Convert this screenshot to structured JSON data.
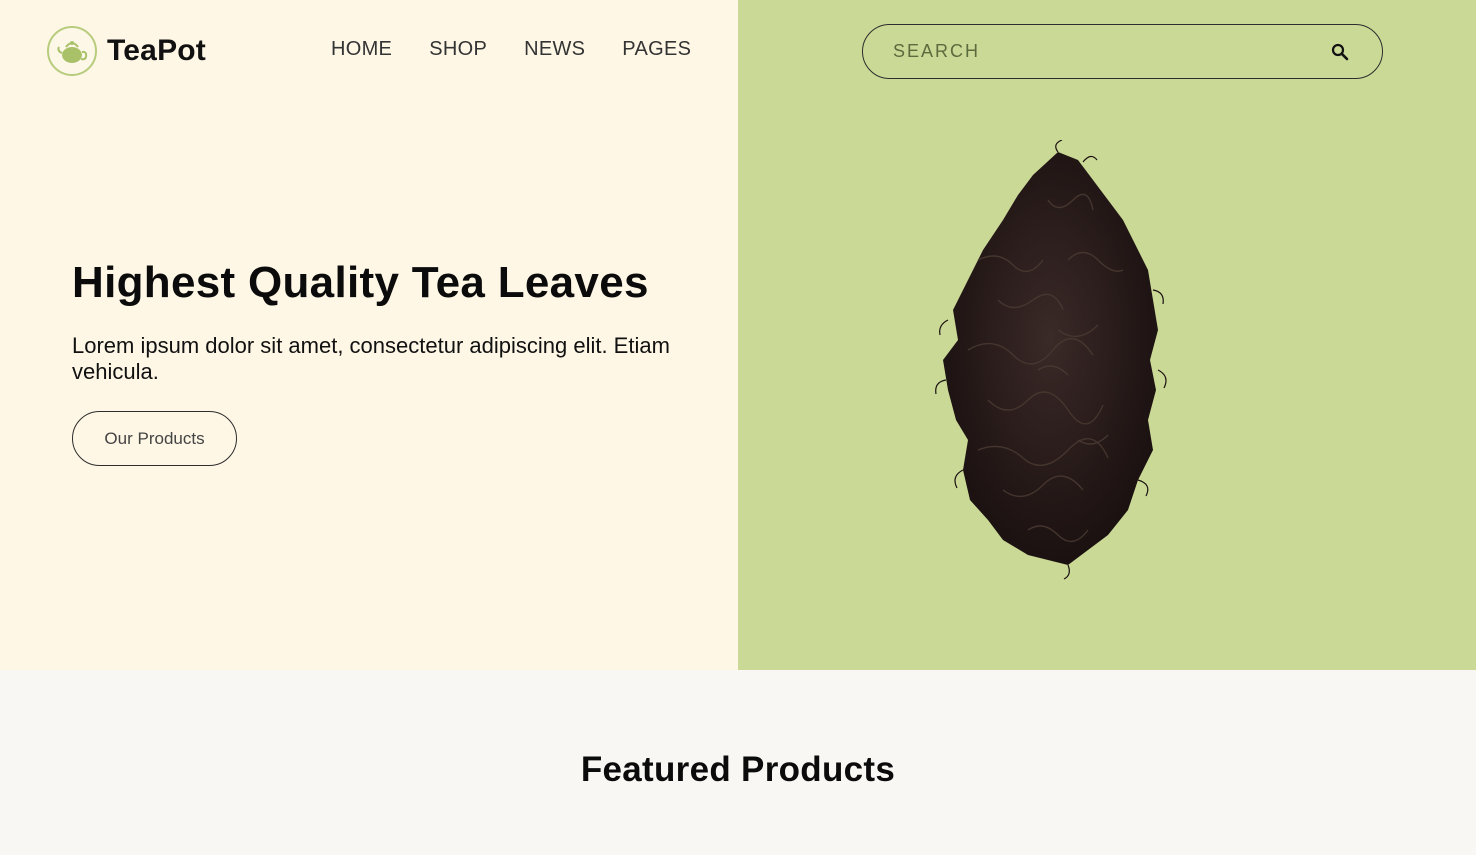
{
  "brand": {
    "name": "TeaPot",
    "icon": "teapot-icon"
  },
  "nav": {
    "items": [
      {
        "label": "HOME"
      },
      {
        "label": "SHOP"
      },
      {
        "label": "NEWS"
      },
      {
        "label": "PAGES"
      }
    ]
  },
  "search": {
    "placeholder": "SEARCH",
    "value": "",
    "icon": "search-icon"
  },
  "hero": {
    "title": "Highest Quality Tea Leaves",
    "description": "Lorem ipsum dolor sit amet, consectetur adipiscing elit. Etiam vehicula.",
    "cta_label": "Our Products",
    "image": "tea-leaves-image"
  },
  "featured": {
    "title": "Featured Products"
  },
  "colors": {
    "hero_left_bg": "#fef7e6",
    "hero_right_bg": "#cbd997",
    "accent": "#b7cc7c",
    "page_bg": "#f8f7f3"
  }
}
